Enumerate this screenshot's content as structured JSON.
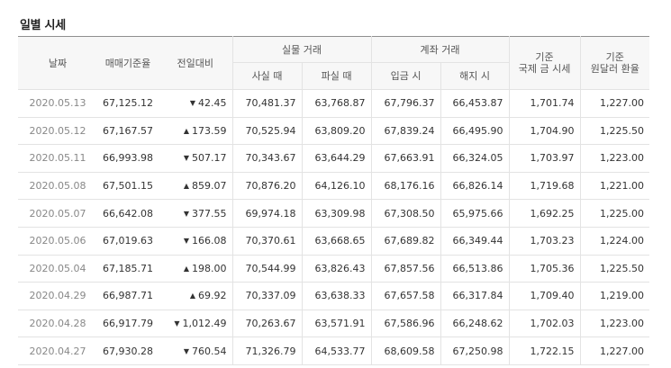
{
  "section_title": "일별 시세",
  "headers": {
    "date": "날짜",
    "base_rate": "매매기준율",
    "change": "전일대비",
    "physical": "실물 거래",
    "buy_physical": "사실 때",
    "sell_physical": "파실 때",
    "account": "계좌 거래",
    "deposit": "입금 시",
    "withdraw": "해지 시",
    "intl_gold_line1": "기준",
    "intl_gold_line2": "국제 금 시세",
    "fx_line1": "기준",
    "fx_line2": "원달러 환율"
  },
  "rows": [
    {
      "date": "2020.05.13",
      "rate": "67,125.12",
      "dir": "down",
      "arrow": "▼",
      "change": "42.45",
      "buy": "70,481.37",
      "sell": "63,768.87",
      "deposit": "67,796.37",
      "withdraw": "66,453.87",
      "gold": "1,701.74",
      "fx": "1,227.00"
    },
    {
      "date": "2020.05.12",
      "rate": "67,167.57",
      "dir": "up",
      "arrow": "▲",
      "change": "173.59",
      "buy": "70,525.94",
      "sell": "63,809.20",
      "deposit": "67,839.24",
      "withdraw": "66,495.90",
      "gold": "1,704.90",
      "fx": "1,225.50"
    },
    {
      "date": "2020.05.11",
      "rate": "66,993.98",
      "dir": "down",
      "arrow": "▼",
      "change": "507.17",
      "buy": "70,343.67",
      "sell": "63,644.29",
      "deposit": "67,663.91",
      "withdraw": "66,324.05",
      "gold": "1,703.97",
      "fx": "1,223.00"
    },
    {
      "date": "2020.05.08",
      "rate": "67,501.15",
      "dir": "up",
      "arrow": "▲",
      "change": "859.07",
      "buy": "70,876.20",
      "sell": "64,126.10",
      "deposit": "68,176.16",
      "withdraw": "66,826.14",
      "gold": "1,719.68",
      "fx": "1,221.00"
    },
    {
      "date": "2020.05.07",
      "rate": "66,642.08",
      "dir": "down",
      "arrow": "▼",
      "change": "377.55",
      "buy": "69,974.18",
      "sell": "63,309.98",
      "deposit": "67,308.50",
      "withdraw": "65,975.66",
      "gold": "1,692.25",
      "fx": "1,225.00"
    },
    {
      "date": "2020.05.06",
      "rate": "67,019.63",
      "dir": "down",
      "arrow": "▼",
      "change": "166.08",
      "buy": "70,370.61",
      "sell": "63,668.65",
      "deposit": "67,689.82",
      "withdraw": "66,349.44",
      "gold": "1,703.23",
      "fx": "1,224.00"
    },
    {
      "date": "2020.05.04",
      "rate": "67,185.71",
      "dir": "up",
      "arrow": "▲",
      "change": "198.00",
      "buy": "70,544.99",
      "sell": "63,826.43",
      "deposit": "67,857.56",
      "withdraw": "66,513.86",
      "gold": "1,705.36",
      "fx": "1,225.50"
    },
    {
      "date": "2020.04.29",
      "rate": "66,987.71",
      "dir": "up",
      "arrow": "▲",
      "change": "69.92",
      "buy": "70,337.09",
      "sell": "63,638.33",
      "deposit": "67,657.58",
      "withdraw": "66,317.84",
      "gold": "1,709.40",
      "fx": "1,219.00"
    },
    {
      "date": "2020.04.28",
      "rate": "66,917.79",
      "dir": "down",
      "arrow": "▼",
      "change": "1,012.49",
      "buy": "70,263.67",
      "sell": "63,571.91",
      "deposit": "67,586.96",
      "withdraw": "66,248.62",
      "gold": "1,702.03",
      "fx": "1,223.00"
    },
    {
      "date": "2020.04.27",
      "rate": "67,930.28",
      "dir": "down",
      "arrow": "▼",
      "change": "760.54",
      "buy": "71,326.79",
      "sell": "64,533.77",
      "deposit": "68,609.58",
      "withdraw": "67,250.98",
      "gold": "1,722.15",
      "fx": "1,227.00"
    }
  ]
}
